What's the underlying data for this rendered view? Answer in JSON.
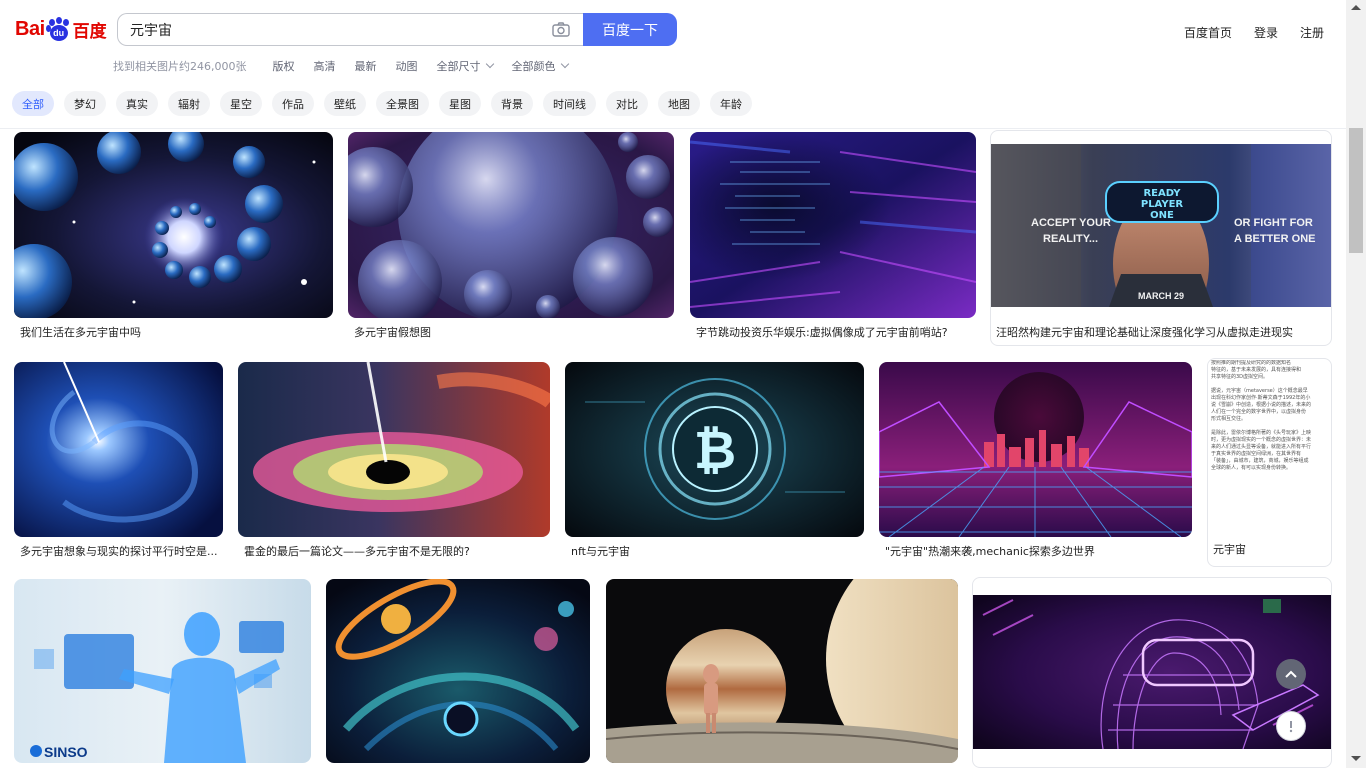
{
  "header": {
    "logo_bai": "Bai",
    "logo_du": "du",
    "logo_cn": "百度",
    "search_value": "元宇宙",
    "search_button": "百度一下",
    "links": [
      "百度首页",
      "登录",
      "注册"
    ]
  },
  "filters": {
    "result_count": "找到相关图片约246,000张",
    "items": [
      "版权",
      "高清",
      "最新",
      "动图"
    ],
    "dropdowns": [
      "全部尺寸",
      "全部颜色"
    ]
  },
  "tags": [
    "全部",
    "梦幻",
    "真实",
    "辐射",
    "星空",
    "作品",
    "壁纸",
    "全景图",
    "星图",
    "背景",
    "时间线",
    "对比",
    "地图",
    "年龄"
  ],
  "results": {
    "row1": [
      "我们生活在多元宇宙中吗",
      "多元宇宙假想图",
      "字节跳动投资乐华娱乐:虚拟偶像成了元宇宙前哨站?",
      "汪昭然构建元宇宙和理论基础让深度强化学习从虚拟走进现实"
    ],
    "row2": [
      "多元宇宙想象与现实的探讨平行时空是...",
      "霍金的最后一篇论文——多元宇宙不是无限的?",
      "nft与元宇宙",
      "\"元宇宙\"热潮来袭,mechanic探索多边世界",
      "元宇宙"
    ],
    "row3": [
      "",
      "",
      "",
      ""
    ]
  },
  "image_text": {
    "poster_title_1": "READY",
    "poster_title_2": "PLAYER",
    "poster_title_3": "ONE",
    "poster_left": "ACCEPT YOUR",
    "poster_left2": "REALITY...",
    "poster_right": "OR FIGHT FOR",
    "poster_right2": "A BETTER ONE",
    "poster_date": "MARCH 29",
    "sinso_logo": "SINSO",
    "doc_lines": [
      "按照推的期刊提及研究的的数据知名",
      "特征的，基于未来发展的，具有连接得和",
      "共享特征的3D虚拟空间。",
      "",
      "据说，元宇宙（metaverse）这个概念最早",
      "出现在科幻作家创作·斯蒂文森于1992年的小",
      "说《雪崩》中创造，根据小说的描述，未来的",
      "人们在一个完全的数字世界中，以虚拟身份",
      "形式相互交往。",
      "",
      "是除此，雷依尔博格所著的《头号玩家》上映",
      "时，更为虚拟现实的一个概念的虚拟世界：未",
      "来的人们通过头显等设备，就能进入所有平行",
      "于真实世界的虚拟空间绿洲，在其世界有",
      "「装备」，由城市，建筑，商城，娱乐等组成",
      "全球的新人，有可以实现身份转换。"
    ]
  },
  "colors": {
    "accent": "#4e6ef2",
    "brand_red": "#e10601",
    "brand_blue": "#2932e1",
    "tag_active_bg": "#e2e8fd",
    "tag_active_text": "#315efb"
  },
  "icons": [
    "camera-icon",
    "chevron-down-icon",
    "back-to-top-icon",
    "feedback-icon",
    "scroll-up-icon",
    "scroll-down-icon"
  ]
}
